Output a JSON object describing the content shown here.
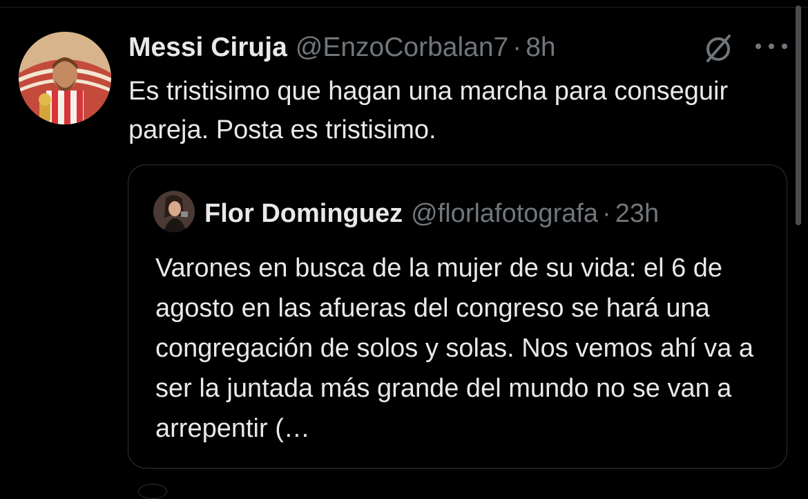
{
  "tweet": {
    "author": {
      "display_name": "Messi Ciruja",
      "handle": "@EnzoCorbalan7",
      "separator": "·",
      "time": "8h"
    },
    "text": "Es tristisimo que hagan una marcha para conseguir pareja. Posta es tristisimo.",
    "quote": {
      "author": {
        "display_name": "Flor Dominguez",
        "handle": "@florlafotografa",
        "separator": "·",
        "time": "23h"
      },
      "text": "Varones en busca de la mujer de su vida: el 6 de agosto en las afueras del congreso se hará una congregación de solos y solas. Nos vemos ahí va a ser la juntada más grande del mundo no se van a arrepentir (…"
    }
  },
  "icons": {
    "grok": "grok-icon",
    "more": "more-icon"
  },
  "colors": {
    "background": "#000000",
    "primary_text": "#e7e9ea",
    "secondary_text": "#71767b",
    "border": "#2f3336"
  }
}
